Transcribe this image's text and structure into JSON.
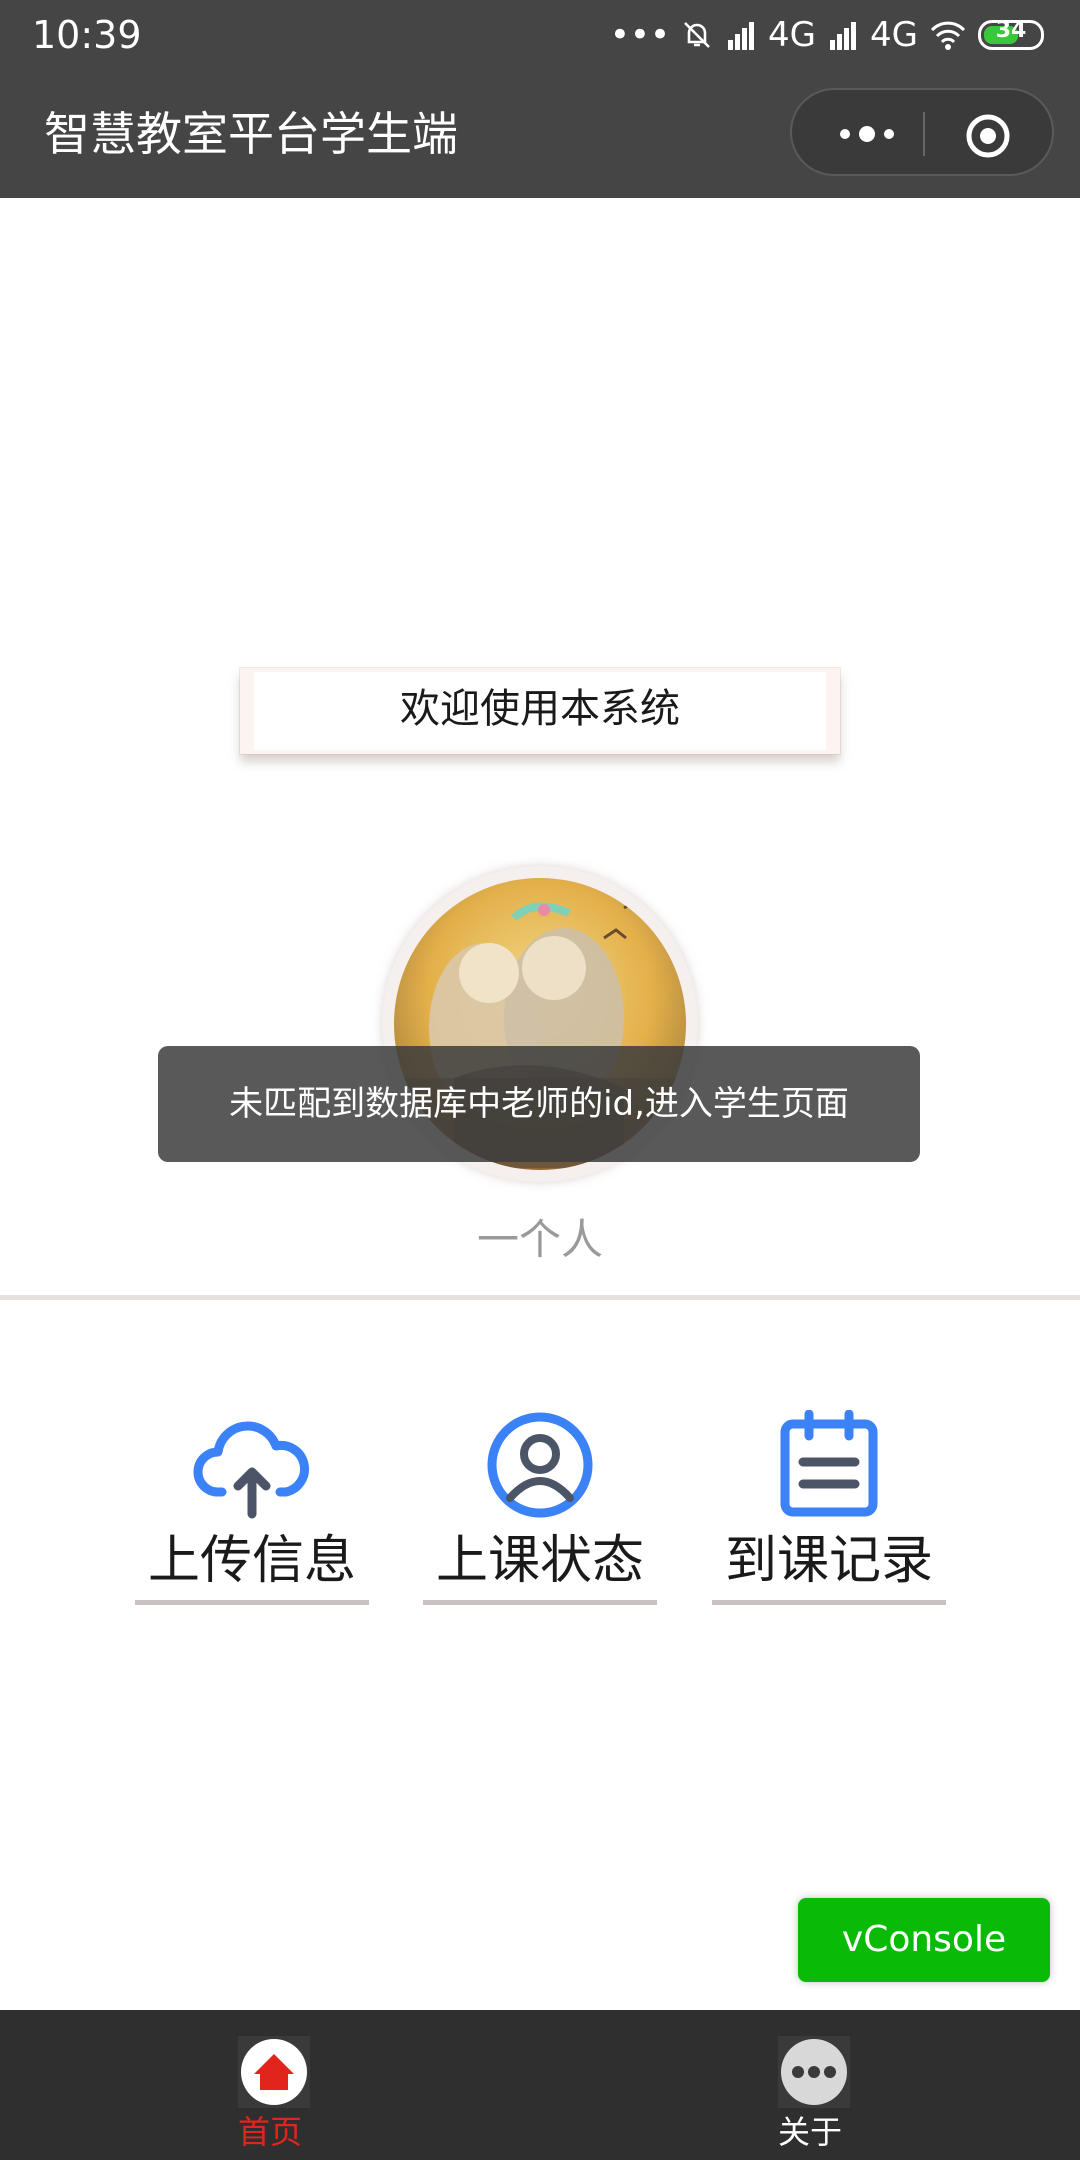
{
  "status_bar": {
    "time": "10:39",
    "network1": "4G",
    "network2": "4G",
    "battery": "34"
  },
  "nav": {
    "title": "智慧教室平台学生端"
  },
  "welcome": {
    "text": "欢迎使用本系统"
  },
  "profile": {
    "nickname": "一个人"
  },
  "menu": [
    {
      "label": "上传信息",
      "icon": "cloud-upload-icon"
    },
    {
      "label": "上课状态",
      "icon": "user-circle-icon"
    },
    {
      "label": "到课记录",
      "icon": "calendar-icon"
    }
  ],
  "toast": {
    "message": "未匹配到数据库中老师的id,进入学生页面"
  },
  "vconsole": {
    "label": "vConsole"
  },
  "tabbar": {
    "items": [
      {
        "label": "首页",
        "icon": "home-icon",
        "active": true,
        "color": "#e0261c"
      },
      {
        "label": "关于",
        "icon": "more-icon",
        "active": false,
        "color": "#ffffff"
      }
    ]
  },
  "colors": {
    "bar_bg": "#454545",
    "icon_blue": "#3b82f6",
    "icon_dark": "#4c5568",
    "vconsole_green": "#09bb07"
  }
}
